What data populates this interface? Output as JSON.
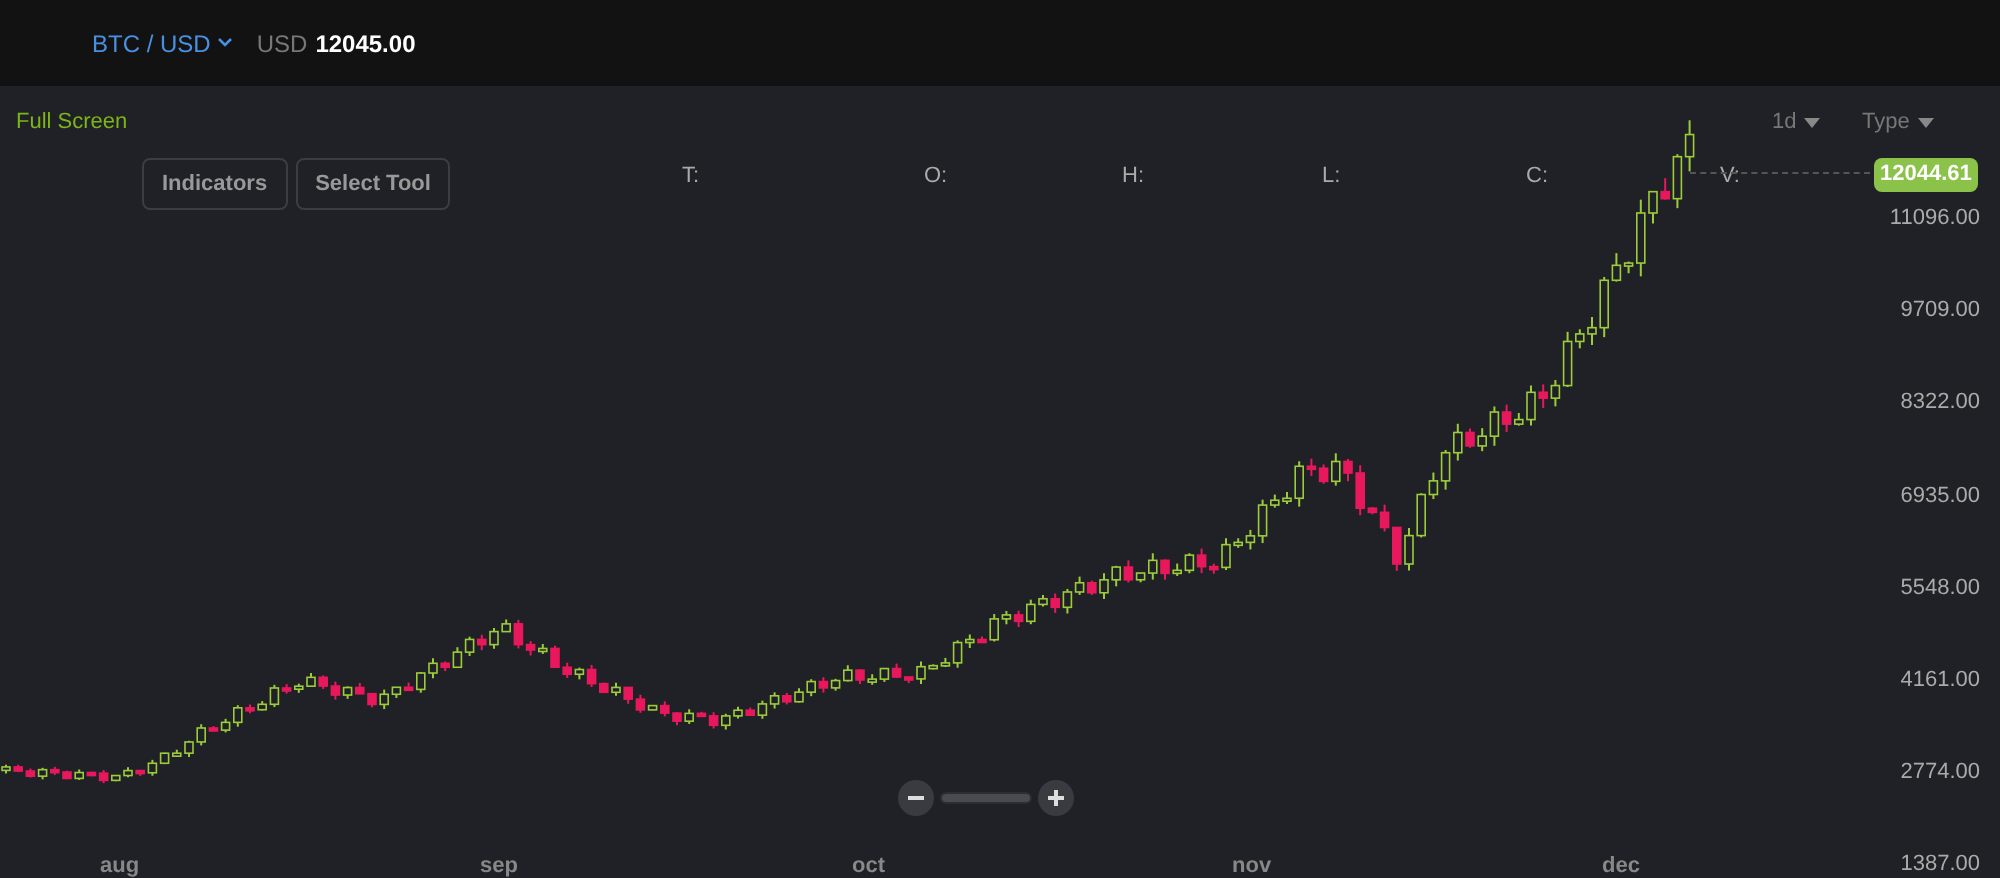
{
  "header": {
    "pair": "BTC / USD",
    "currency": "USD",
    "price": "12045.00"
  },
  "toolbar": {
    "full_screen": "Full Screen",
    "interval": "1d",
    "type": "Type"
  },
  "buttons": [
    "Indicators",
    "Select Tool"
  ],
  "ohlc_labels": [
    "T:",
    "O:",
    "H:",
    "L:",
    "C:",
    "V:"
  ],
  "chart": {
    "current_price": "12044.61",
    "y_axis": [
      "11096.00",
      "9709.00",
      "8322.00",
      "6935.00",
      "5548.00",
      "4161.00",
      "2774.00",
      "1387.00"
    ],
    "x_axis": [
      "aug",
      "sep",
      "oct",
      "nov",
      "dec"
    ]
  },
  "zoom_slider": {
    "level": 1
  }
}
